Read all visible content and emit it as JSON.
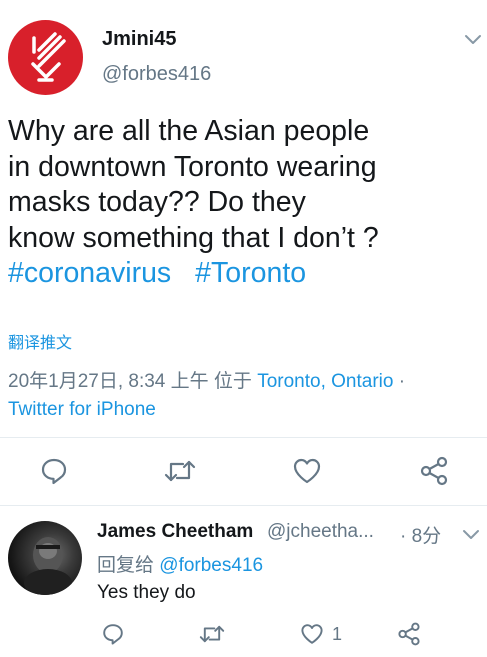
{
  "tweet": {
    "author_name": "Jmini45",
    "author_handle": "@forbes416",
    "text_lines": [
      "Why are all the Asian people",
      "in downtown Toronto wearing",
      "masks today??  Do they",
      "know something that I don’t ?"
    ],
    "hashtags": [
      "#coronavirus",
      "#Toronto"
    ],
    "translate_label": "翻译推文",
    "timestamp": "20年1月27日, 8:34 上午 位于 ",
    "location": "Toronto, Ontario",
    "dot": " ·",
    "source": "Twitter for iPhone",
    "avatar_color": "#d8202b",
    "link_color": "#1b95e0"
  },
  "actions": {
    "reply_icon": "reply-icon",
    "retweet_icon": "retweet-icon",
    "like_icon": "heart-icon",
    "share_icon": "share-icon"
  },
  "reply": {
    "author_name": "James Cheetham",
    "author_handle": "@jcheetha...",
    "time": "· 8分",
    "replying_to_label": "回复给 ",
    "replying_to_handle": "@forbes416",
    "text": "Yes they do",
    "like_count": "1"
  }
}
